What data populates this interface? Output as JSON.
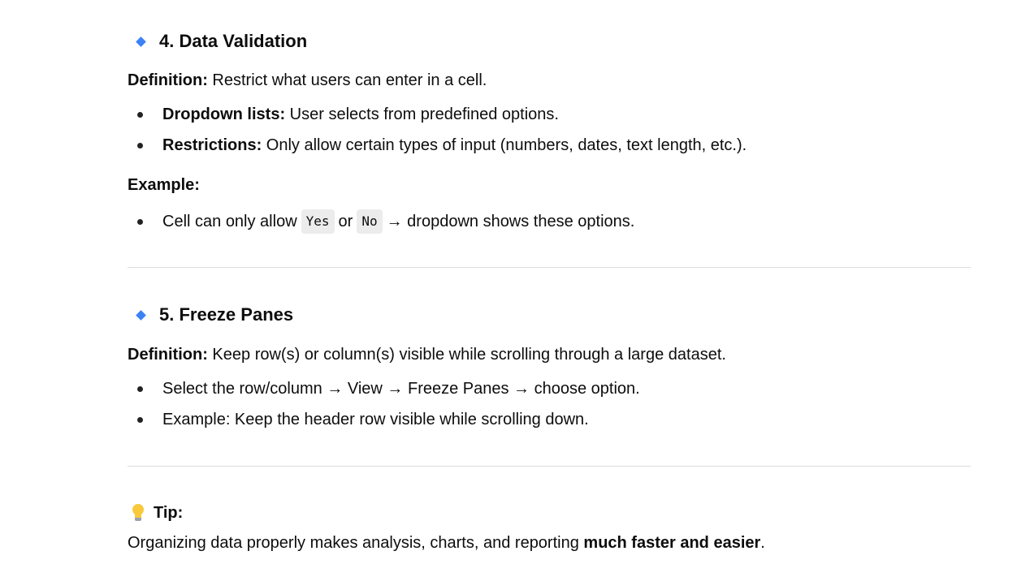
{
  "section4": {
    "heading": "4. Data Validation",
    "definition_label": "Definition:",
    "definition_text": " Restrict what users can enter in a cell.",
    "bullets": [
      {
        "label": "Dropdown lists:",
        "text": " User selects from predefined options."
      },
      {
        "label": "Restrictions:",
        "text": " Only allow certain types of input (numbers, dates, text length, etc.)."
      }
    ],
    "example_label": "Example:",
    "example_bullet": {
      "prefix": "Cell can only allow",
      "code1": "Yes",
      "middle": "or",
      "code2": "No",
      "suffix": "→ dropdown shows these options."
    }
  },
  "section5": {
    "heading": "5. Freeze Panes",
    "definition_label": "Definition:",
    "definition_text": " Keep row(s) or column(s) visible while scrolling through a large dataset.",
    "bullets": [
      "Select the row/column → View → Freeze Panes → choose option.",
      "Example: Keep the header row visible while scrolling down."
    ]
  },
  "tip": {
    "icon": "lightbulb-icon",
    "label": "Tip:",
    "text_prefix": "Organizing data properly makes analysis, charts, and reporting ",
    "text_bold": "much faster and easier",
    "text_suffix": "."
  },
  "colors": {
    "diamond": "#3b82f6",
    "rule": "#dcdcdc",
    "code_bg": "#ececec"
  }
}
